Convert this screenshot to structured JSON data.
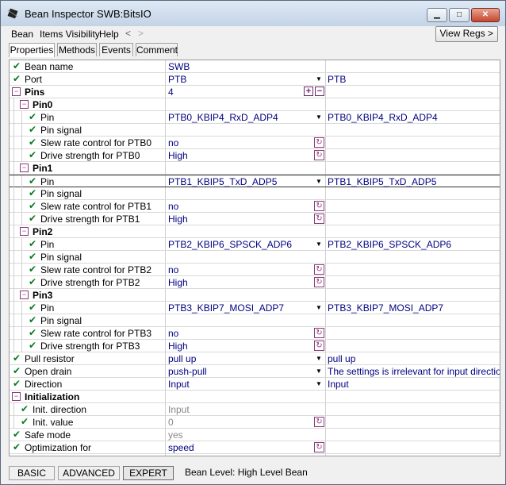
{
  "window": {
    "title": "Bean Inspector SWB:BitsIO"
  },
  "menu": {
    "items": [
      "Bean",
      "Items Visibility",
      "Help"
    ],
    "back": "<",
    "forward": ">",
    "view_regs": "View Regs >"
  },
  "tabs": [
    "Properties",
    "Methods",
    "Events",
    "Comment"
  ],
  "rows": [
    {
      "label": "Bean name",
      "value": "SWB",
      "value2": ""
    },
    {
      "label": "Port",
      "value": "PTB",
      "value2": "PTB"
    },
    {
      "label": "Pins",
      "value": "4",
      "value2": ""
    },
    {
      "label": "Pin0",
      "value": "",
      "value2": ""
    },
    {
      "label": "Pin",
      "value": "PTB0_KBIP4_RxD_ADP4",
      "value2": "PTB0_KBIP4_RxD_ADP4"
    },
    {
      "label": "Pin signal",
      "value": "",
      "value2": ""
    },
    {
      "label": "Slew rate control for PTB0",
      "value": "no",
      "value2": ""
    },
    {
      "label": "Drive strength for PTB0",
      "value": "High",
      "value2": ""
    },
    {
      "label": "Pin1",
      "value": "",
      "value2": ""
    },
    {
      "label": "Pin",
      "value": "PTB1_KBIP5_TxD_ADP5",
      "value2": "PTB1_KBIP5_TxD_ADP5"
    },
    {
      "label": "Pin signal",
      "value": "",
      "value2": ""
    },
    {
      "label": "Slew rate control for PTB1",
      "value": "no",
      "value2": ""
    },
    {
      "label": "Drive strength for PTB1",
      "value": "High",
      "value2": ""
    },
    {
      "label": "Pin2",
      "value": "",
      "value2": ""
    },
    {
      "label": "Pin",
      "value": "PTB2_KBIP6_SPSCK_ADP6",
      "value2": "PTB2_KBIP6_SPSCK_ADP6"
    },
    {
      "label": "Pin signal",
      "value": "",
      "value2": ""
    },
    {
      "label": "Slew rate control for PTB2",
      "value": "no",
      "value2": ""
    },
    {
      "label": "Drive strength for PTB2",
      "value": "High",
      "value2": ""
    },
    {
      "label": "Pin3",
      "value": "",
      "value2": ""
    },
    {
      "label": "Pin",
      "value": "PTB3_KBIP7_MOSI_ADP7",
      "value2": "PTB3_KBIP7_MOSI_ADP7"
    },
    {
      "label": "Pin signal",
      "value": "",
      "value2": ""
    },
    {
      "label": "Slew rate control for PTB3",
      "value": "no",
      "value2": ""
    },
    {
      "label": "Drive strength for PTB3",
      "value": "High",
      "value2": ""
    },
    {
      "label": "Pull resistor",
      "value": "pull up",
      "value2": "pull up"
    },
    {
      "label": "Open drain",
      "value": "push-pull",
      "value2": "The settings is irrelevant for input direction"
    },
    {
      "label": "Direction",
      "value": "Input",
      "value2": "Input"
    },
    {
      "label": "Initialization",
      "value": "",
      "value2": ""
    },
    {
      "label": "Init. direction",
      "value": "Input",
      "value2": ""
    },
    {
      "label": "Init. value",
      "value": "0",
      "value2": ""
    },
    {
      "label": "Safe mode",
      "value": "yes",
      "value2": ""
    },
    {
      "label": "Optimization for",
      "value": "speed",
      "value2": ""
    }
  ],
  "levels": [
    "BASIC",
    "ADVANCED",
    "EXPERT"
  ],
  "status": "Bean Level: High Level Bean",
  "glyphs": {
    "check": "✔",
    "minus": "−",
    "plus": "+",
    "dropdown": "▼",
    "cycle": "↻",
    "close": "✕",
    "min": "▁",
    "max": "□"
  }
}
